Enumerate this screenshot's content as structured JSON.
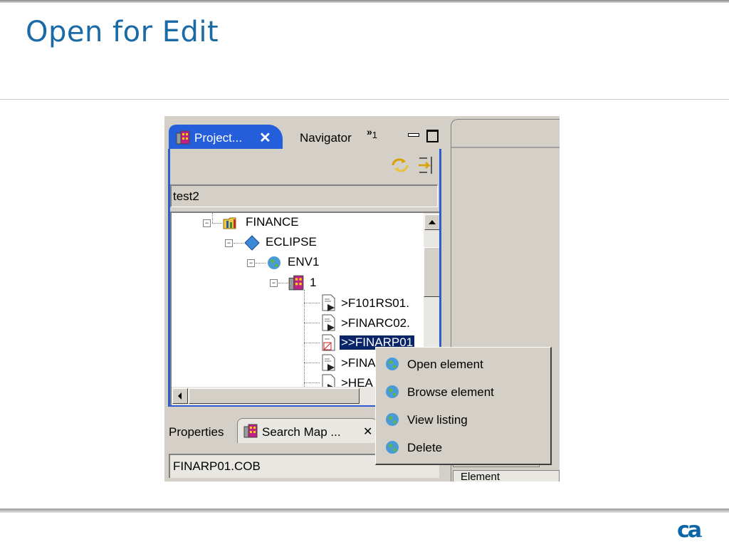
{
  "slide": {
    "title": "Open for Edit"
  },
  "project_view": {
    "tabs": {
      "active_label": "Project...",
      "close_glyph": "✕",
      "navigator_label": "Navigator",
      "overflow_glyph": "»",
      "overflow_count": "1"
    },
    "filter_value": "test2",
    "tree": {
      "finance": "FINANCE",
      "eclipse": "ECLIPSE",
      "env1": "ENV1",
      "system": "1",
      "elements": [
        ">F101RS01.",
        ">FINARC02.",
        ">>FINARP01",
        ">FINA",
        ">HEA"
      ]
    }
  },
  "bottom_panel": {
    "tab_properties": "Properties",
    "tab_search_map": "Search Map ...",
    "tab_close_glyph": "✕",
    "field_value": "FINARP01.COB"
  },
  "right_panel": {
    "header": "Element"
  },
  "context_menu": {
    "items": [
      "Open element",
      "Browse element",
      "View listing",
      "Delete"
    ]
  },
  "brand": {
    "logo_text": "ca",
    "logo_dot": "."
  },
  "colors": {
    "title_blue": "#1a6aa6",
    "tab_blue": "#245edb",
    "selection": "#0a246a",
    "logo_blue": "#0b66a8"
  }
}
